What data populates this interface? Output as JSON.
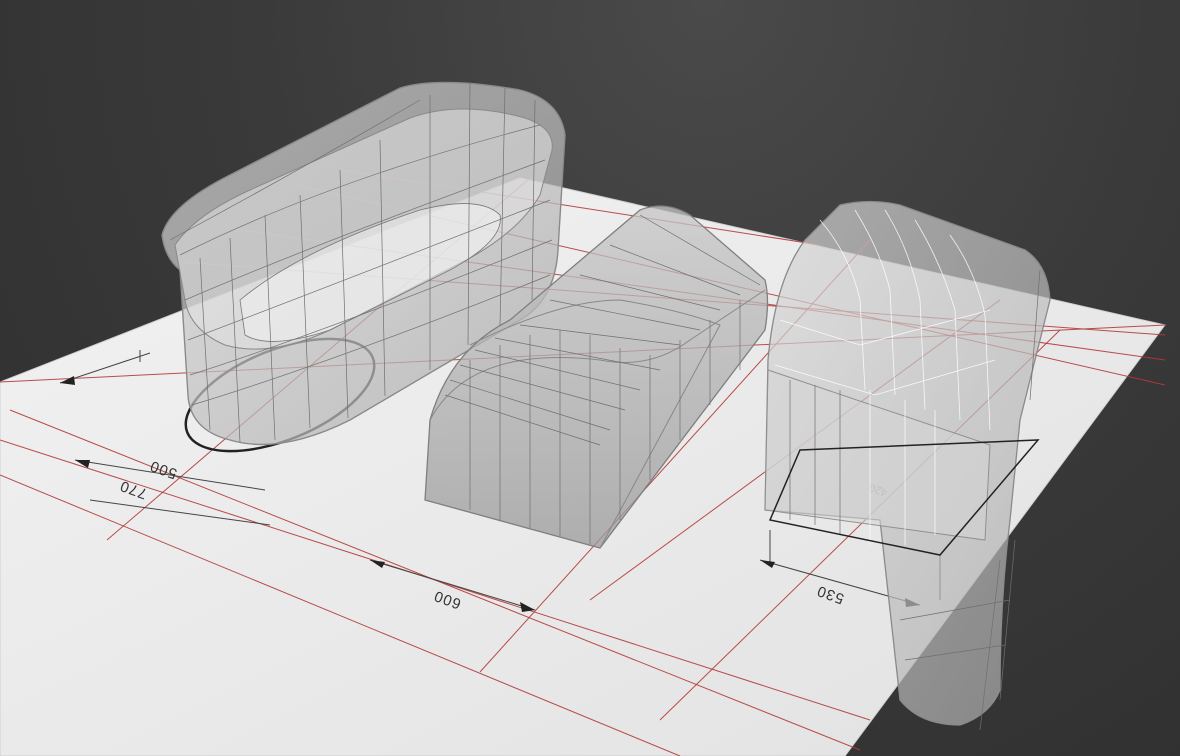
{
  "dimensions": [
    {
      "id": "dim-500",
      "value": "500"
    },
    {
      "id": "dim-770",
      "value": "770"
    },
    {
      "id": "dim-600",
      "value": "600"
    },
    {
      "id": "dim-530",
      "value": "530"
    },
    {
      "id": "dim-420",
      "value": "420"
    }
  ],
  "colors": {
    "background": "#3a3a3a",
    "ground_plane": "#ececec",
    "mesh": "#cfcfcf",
    "grid_line": "#b23a3a"
  }
}
